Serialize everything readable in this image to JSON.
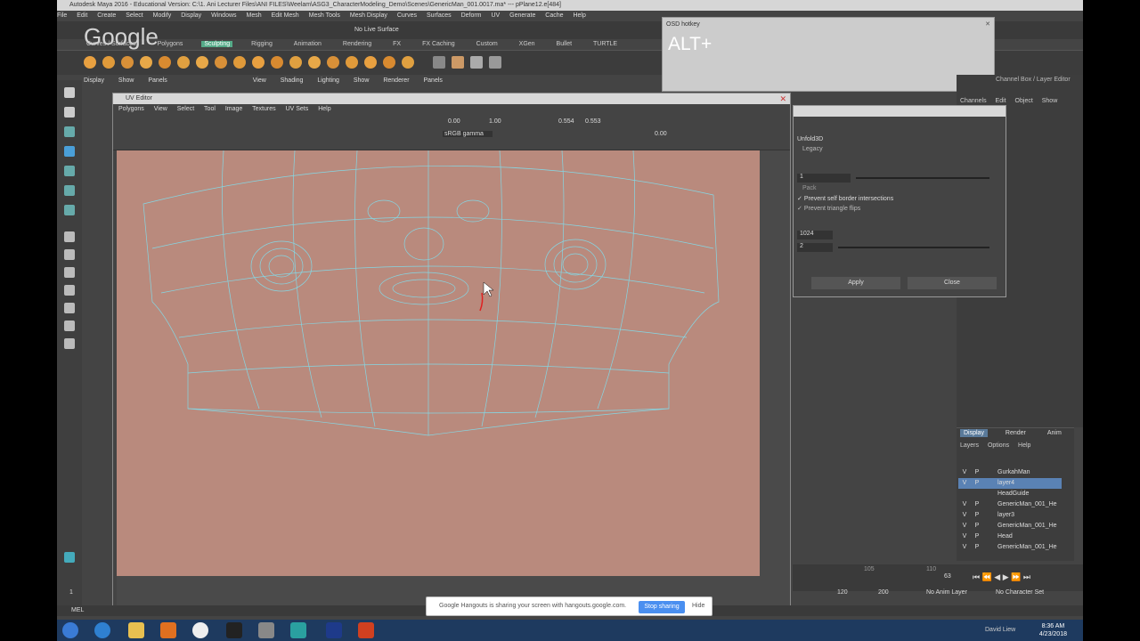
{
  "window": {
    "title": "Autodesk Maya 2016 - Educational Version: C:\\1. Ani Lecturer Files\\ANI FILES\\Weelam\\ASG3_CharacterModeling_Demo\\Scenes\\GenericMan_001.0017.ma*    ---    pPlane12.e[484]"
  },
  "menubar": [
    "File",
    "Edit",
    "Create",
    "Select",
    "Modify",
    "Display",
    "Windows",
    "Mesh",
    "Edit Mesh",
    "Mesh Tools",
    "Mesh Display",
    "Curves",
    "Surfaces",
    "Deform",
    "UV",
    "Generate",
    "Cache",
    "Help"
  ],
  "statusbar": {
    "no_live_surface": "No Live Surface"
  },
  "google_logo": "Google",
  "shelf_tabs": [
    "Curves / Surfaces",
    "Polygons",
    "Sculpting",
    "Rigging",
    "Animation",
    "Rendering",
    "FX",
    "FX Caching",
    "Custom",
    "XGen",
    "Bullet",
    "TURTLE"
  ],
  "shelf_active": "Sculpting",
  "viewport_menu": [
    "Display",
    "Show",
    "Panels",
    "View",
    "Shading",
    "Lighting",
    "Show",
    "Renderer",
    "Panels"
  ],
  "uv_editor": {
    "title": "UV Editor",
    "menu": [
      "Polygons",
      "View",
      "Select",
      "Tool",
      "Image",
      "Textures",
      "UV Sets",
      "Help"
    ],
    "val_a": "0.00",
    "val_b": "1.00",
    "val_c": "0.554",
    "val_d": "0.553",
    "val_e": "0.00",
    "colorspace": "sRGB gamma"
  },
  "osd": {
    "title": "OSD hotkey",
    "key": "ALT+"
  },
  "unfold": {
    "method": "Unfold3D",
    "legacy": "Legacy",
    "iterations": "1",
    "pack": "Pack",
    "prevent_border": "Prevent self border intersections",
    "prevent_flips": "Prevent triangle flips",
    "map_size": "1024",
    "room_space": "2",
    "apply": "Apply",
    "close": "Close"
  },
  "right_panel": {
    "tabs": [
      "Channels",
      "Edit",
      "Object",
      "Show"
    ],
    "layer_editor": "Channel Box / Layer Editor"
  },
  "layers": {
    "tabs": [
      "Display",
      "Render",
      "Anim"
    ],
    "menu": [
      "Layers",
      "Options",
      "Help"
    ],
    "active_tab": "Display",
    "rows": [
      {
        "v": "V",
        "p": "P",
        "name": "GurkahMan",
        "selected": false
      },
      {
        "v": "V",
        "p": "P",
        "name": "layer4",
        "selected": true
      },
      {
        "v": "",
        "p": "",
        "name": "HeadGuide",
        "selected": false
      },
      {
        "v": "V",
        "p": "P",
        "name": "GenericMan_001_He",
        "selected": false
      },
      {
        "v": "V",
        "p": "P",
        "name": "layer3",
        "selected": false
      },
      {
        "v": "V",
        "p": "P",
        "name": "GenericMan_001_He",
        "selected": false
      },
      {
        "v": "V",
        "p": "P",
        "name": "Head",
        "selected": false
      },
      {
        "v": "V",
        "p": "P",
        "name": "GenericMan_001_He",
        "selected": false
      }
    ]
  },
  "timeline": {
    "frame": "63",
    "start": "120",
    "end": "200",
    "anim_layer": "No Anim Layer",
    "char_set": "No Character Set"
  },
  "ruler": {
    "n105": "105",
    "n110": "110"
  },
  "left_field": "1",
  "cmdline": "MEL",
  "share": {
    "text": "Google Hangouts is sharing your screen with hangouts.google.com.",
    "stop": "Stop sharing",
    "hide": "Hide"
  },
  "taskbar": {
    "user": "David Liew",
    "time": "8:36 AM",
    "date": "4/23/2018"
  }
}
